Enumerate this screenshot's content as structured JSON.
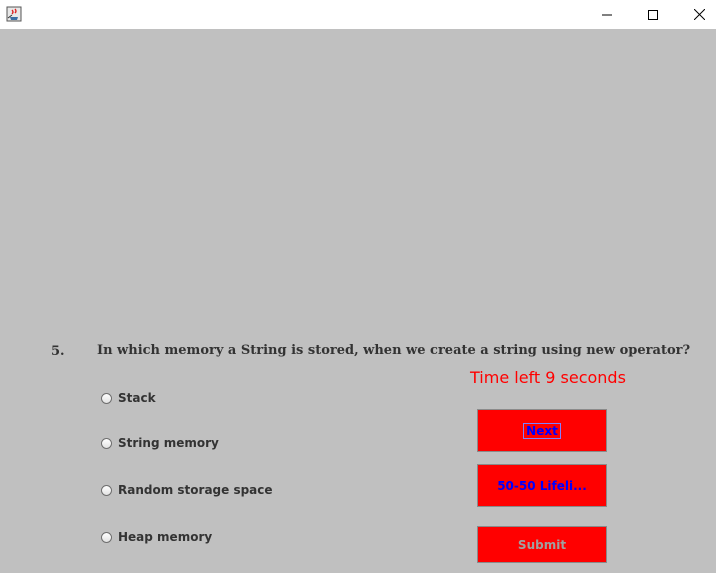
{
  "window": {
    "app_icon": "java-cup-icon",
    "controls": {
      "minimize": "minimize-icon",
      "maximize": "maximize-icon",
      "close": "close-icon"
    }
  },
  "question": {
    "number": "5.",
    "text": "In which memory a String is stored, when we create a string using new operator?"
  },
  "timer": {
    "text": "Time left 9 seconds",
    "color": "#ff0000"
  },
  "options": [
    {
      "label": "Stack",
      "selected": false
    },
    {
      "label": "String memory",
      "selected": false
    },
    {
      "label": "Random storage space",
      "selected": false
    },
    {
      "label": "Heap memory",
      "selected": false
    }
  ],
  "buttons": {
    "next": "Next",
    "lifeline": "50-50 Lifeli...",
    "submit": "Submit"
  },
  "colors": {
    "background": "#c0c0c0",
    "button_bg": "#ff0000",
    "button_text": "#0000ff",
    "submit_text_disabled": "#a0a0a0"
  }
}
